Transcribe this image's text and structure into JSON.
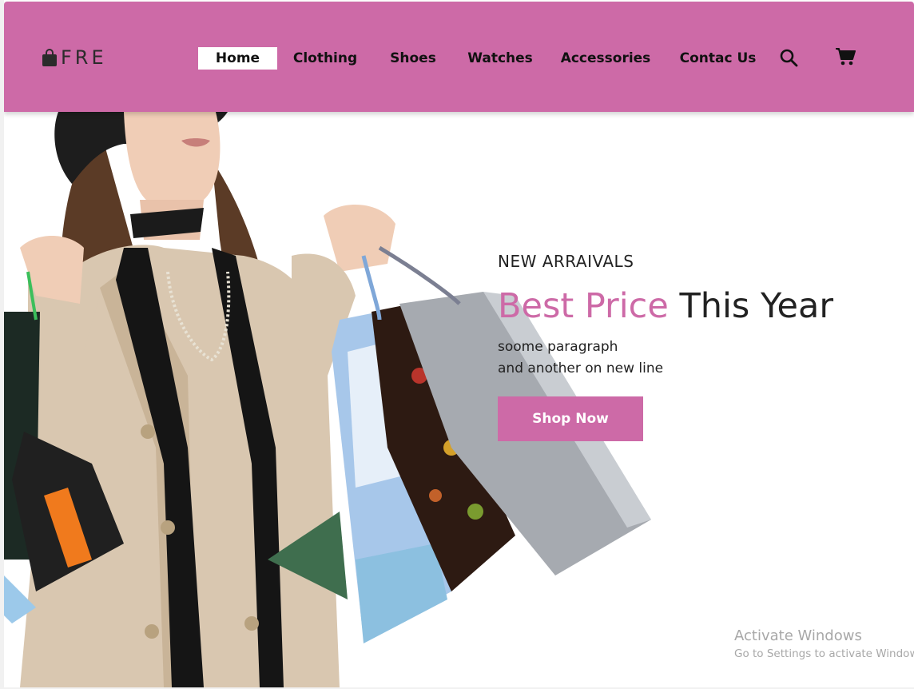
{
  "brand": {
    "name": "FRE",
    "logo_icon": "shopping-bag-icon"
  },
  "nav": {
    "links": [
      {
        "label": "Home",
        "active": true
      },
      {
        "label": "Clothing",
        "active": false
      },
      {
        "label": "Shoes",
        "active": false
      },
      {
        "label": "Watches",
        "active": false
      },
      {
        "label": "Accessories",
        "active": false
      },
      {
        "label": "Contac Us",
        "active": false
      }
    ],
    "icons": [
      "search-icon",
      "cart-icon"
    ]
  },
  "hero": {
    "subtitle": "NEW ARRAIVALS",
    "title_accent": "Best Price",
    "title_rest": "This Year",
    "paragraph_line1": "soome paragraph",
    "paragraph_line2": "and another on new line",
    "button_label": "Shop Now",
    "image": "woman-holding-shopping-bags"
  },
  "watermark": {
    "line1": "Activate Windows",
    "line2": "Go to Settings to activate Windows."
  },
  "colors": {
    "accent": "#cd6aa7",
    "text": "#222222",
    "background": "#ffffff"
  }
}
